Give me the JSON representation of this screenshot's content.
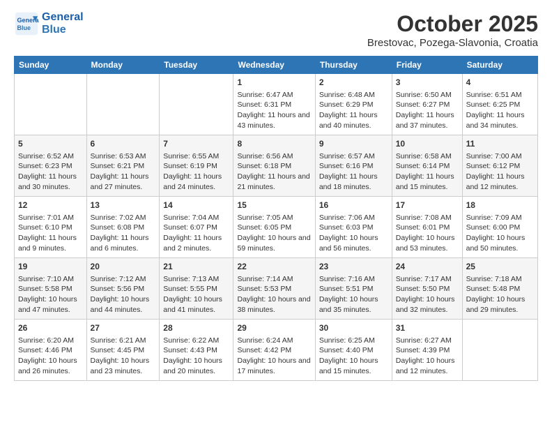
{
  "header": {
    "logo_line1": "General",
    "logo_line2": "Blue",
    "title": "October 2025",
    "subtitle": "Brestovac, Pozega-Slavonia, Croatia"
  },
  "days_of_week": [
    "Sunday",
    "Monday",
    "Tuesday",
    "Wednesday",
    "Thursday",
    "Friday",
    "Saturday"
  ],
  "weeks": [
    [
      {
        "day": "",
        "info": ""
      },
      {
        "day": "",
        "info": ""
      },
      {
        "day": "",
        "info": ""
      },
      {
        "day": "1",
        "info": "Sunrise: 6:47 AM\nSunset: 6:31 PM\nDaylight: 11 hours and 43 minutes."
      },
      {
        "day": "2",
        "info": "Sunrise: 6:48 AM\nSunset: 6:29 PM\nDaylight: 11 hours and 40 minutes."
      },
      {
        "day": "3",
        "info": "Sunrise: 6:50 AM\nSunset: 6:27 PM\nDaylight: 11 hours and 37 minutes."
      },
      {
        "day": "4",
        "info": "Sunrise: 6:51 AM\nSunset: 6:25 PM\nDaylight: 11 hours and 34 minutes."
      }
    ],
    [
      {
        "day": "5",
        "info": "Sunrise: 6:52 AM\nSunset: 6:23 PM\nDaylight: 11 hours and 30 minutes."
      },
      {
        "day": "6",
        "info": "Sunrise: 6:53 AM\nSunset: 6:21 PM\nDaylight: 11 hours and 27 minutes."
      },
      {
        "day": "7",
        "info": "Sunrise: 6:55 AM\nSunset: 6:19 PM\nDaylight: 11 hours and 24 minutes."
      },
      {
        "day": "8",
        "info": "Sunrise: 6:56 AM\nSunset: 6:18 PM\nDaylight: 11 hours and 21 minutes."
      },
      {
        "day": "9",
        "info": "Sunrise: 6:57 AM\nSunset: 6:16 PM\nDaylight: 11 hours and 18 minutes."
      },
      {
        "day": "10",
        "info": "Sunrise: 6:58 AM\nSunset: 6:14 PM\nDaylight: 11 hours and 15 minutes."
      },
      {
        "day": "11",
        "info": "Sunrise: 7:00 AM\nSunset: 6:12 PM\nDaylight: 11 hours and 12 minutes."
      }
    ],
    [
      {
        "day": "12",
        "info": "Sunrise: 7:01 AM\nSunset: 6:10 PM\nDaylight: 11 hours and 9 minutes."
      },
      {
        "day": "13",
        "info": "Sunrise: 7:02 AM\nSunset: 6:08 PM\nDaylight: 11 hours and 6 minutes."
      },
      {
        "day": "14",
        "info": "Sunrise: 7:04 AM\nSunset: 6:07 PM\nDaylight: 11 hours and 2 minutes."
      },
      {
        "day": "15",
        "info": "Sunrise: 7:05 AM\nSunset: 6:05 PM\nDaylight: 10 hours and 59 minutes."
      },
      {
        "day": "16",
        "info": "Sunrise: 7:06 AM\nSunset: 6:03 PM\nDaylight: 10 hours and 56 minutes."
      },
      {
        "day": "17",
        "info": "Sunrise: 7:08 AM\nSunset: 6:01 PM\nDaylight: 10 hours and 53 minutes."
      },
      {
        "day": "18",
        "info": "Sunrise: 7:09 AM\nSunset: 6:00 PM\nDaylight: 10 hours and 50 minutes."
      }
    ],
    [
      {
        "day": "19",
        "info": "Sunrise: 7:10 AM\nSunset: 5:58 PM\nDaylight: 10 hours and 47 minutes."
      },
      {
        "day": "20",
        "info": "Sunrise: 7:12 AM\nSunset: 5:56 PM\nDaylight: 10 hours and 44 minutes."
      },
      {
        "day": "21",
        "info": "Sunrise: 7:13 AM\nSunset: 5:55 PM\nDaylight: 10 hours and 41 minutes."
      },
      {
        "day": "22",
        "info": "Sunrise: 7:14 AM\nSunset: 5:53 PM\nDaylight: 10 hours and 38 minutes."
      },
      {
        "day": "23",
        "info": "Sunrise: 7:16 AM\nSunset: 5:51 PM\nDaylight: 10 hours and 35 minutes."
      },
      {
        "day": "24",
        "info": "Sunrise: 7:17 AM\nSunset: 5:50 PM\nDaylight: 10 hours and 32 minutes."
      },
      {
        "day": "25",
        "info": "Sunrise: 7:18 AM\nSunset: 5:48 PM\nDaylight: 10 hours and 29 minutes."
      }
    ],
    [
      {
        "day": "26",
        "info": "Sunrise: 6:20 AM\nSunset: 4:46 PM\nDaylight: 10 hours and 26 minutes."
      },
      {
        "day": "27",
        "info": "Sunrise: 6:21 AM\nSunset: 4:45 PM\nDaylight: 10 hours and 23 minutes."
      },
      {
        "day": "28",
        "info": "Sunrise: 6:22 AM\nSunset: 4:43 PM\nDaylight: 10 hours and 20 minutes."
      },
      {
        "day": "29",
        "info": "Sunrise: 6:24 AM\nSunset: 4:42 PM\nDaylight: 10 hours and 17 minutes."
      },
      {
        "day": "30",
        "info": "Sunrise: 6:25 AM\nSunset: 4:40 PM\nDaylight: 10 hours and 15 minutes."
      },
      {
        "day": "31",
        "info": "Sunrise: 6:27 AM\nSunset: 4:39 PM\nDaylight: 10 hours and 12 minutes."
      },
      {
        "day": "",
        "info": ""
      }
    ]
  ]
}
